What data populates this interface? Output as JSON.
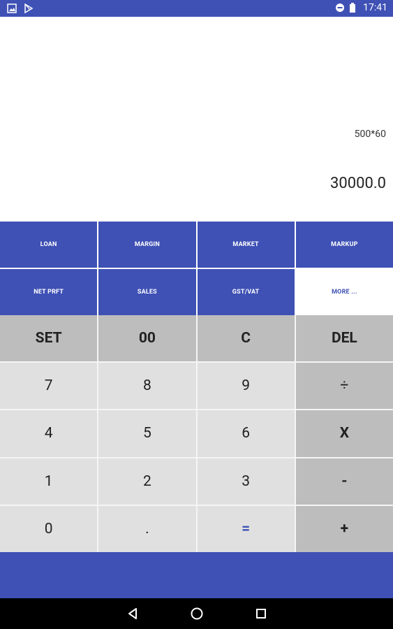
{
  "statusbar": {
    "time": "17:41"
  },
  "display": {
    "expression": "500*60",
    "result": "30000.0"
  },
  "functions": [
    {
      "label": "LOAN"
    },
    {
      "label": "MARGIN"
    },
    {
      "label": "MARKET"
    },
    {
      "label": "MARKUP"
    },
    {
      "label": "NET PRFT"
    },
    {
      "label": "SALES"
    },
    {
      "label": "GST/VAT"
    },
    {
      "label": "MORE ..."
    }
  ],
  "keys": [
    {
      "label": "SET"
    },
    {
      "label": "00"
    },
    {
      "label": "C"
    },
    {
      "label": "DEL"
    },
    {
      "label": "7"
    },
    {
      "label": "8"
    },
    {
      "label": "9"
    },
    {
      "label": "÷"
    },
    {
      "label": "4"
    },
    {
      "label": "5"
    },
    {
      "label": "6"
    },
    {
      "label": "X"
    },
    {
      "label": "1"
    },
    {
      "label": "2"
    },
    {
      "label": "3"
    },
    {
      "label": "-"
    },
    {
      "label": "0"
    },
    {
      "label": "."
    },
    {
      "label": "="
    },
    {
      "label": "+"
    }
  ],
  "colors": {
    "primary": "#3f51b5",
    "key_light": "#e0e0e0",
    "key_dark": "#bdbdbd"
  }
}
